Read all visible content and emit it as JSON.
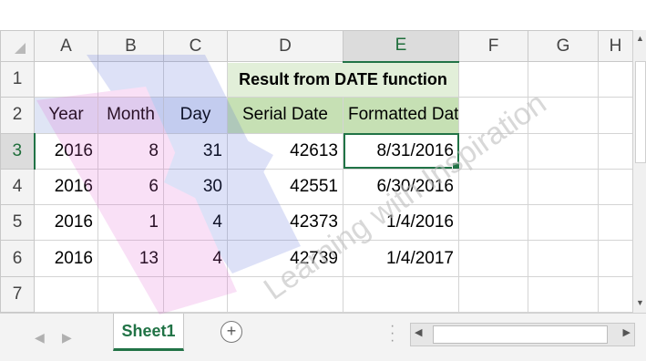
{
  "columns": [
    "A",
    "B",
    "C",
    "D",
    "E",
    "F",
    "G",
    "H"
  ],
  "rows": [
    {
      "num": "1",
      "cells": [
        "",
        "",
        "",
        "Result from DATE function",
        "",
        "",
        "",
        ""
      ]
    },
    {
      "num": "2",
      "cells": [
        "Year",
        "Month",
        "Day",
        "Serial Date",
        "Formatted Date",
        "",
        "",
        ""
      ]
    },
    {
      "num": "3",
      "cells": [
        "2016",
        "8",
        "31",
        "42613",
        "8/31/2016",
        "",
        "",
        ""
      ]
    },
    {
      "num": "4",
      "cells": [
        "2016",
        "6",
        "30",
        "42551",
        "6/30/2016",
        "",
        "",
        ""
      ]
    },
    {
      "num": "5",
      "cells": [
        "2016",
        "1",
        "4",
        "42373",
        "1/4/2016",
        "",
        "",
        ""
      ]
    },
    {
      "num": "6",
      "cells": [
        "2016",
        "13",
        "4",
        "42739",
        "1/4/2017",
        "",
        "",
        ""
      ]
    },
    {
      "num": "7",
      "cells": [
        "",
        "",
        "",
        "",
        "",
        "",
        "",
        ""
      ]
    }
  ],
  "sheet": {
    "active_tab": "Sheet1",
    "add_symbol": "+"
  },
  "watermark": {
    "text": "Learning with Inspiration"
  },
  "colors": {
    "accent": "#217346",
    "header_blue": "#dfe5f5",
    "header_green": "#c6e0b4",
    "title_green": "#e2efd9"
  }
}
